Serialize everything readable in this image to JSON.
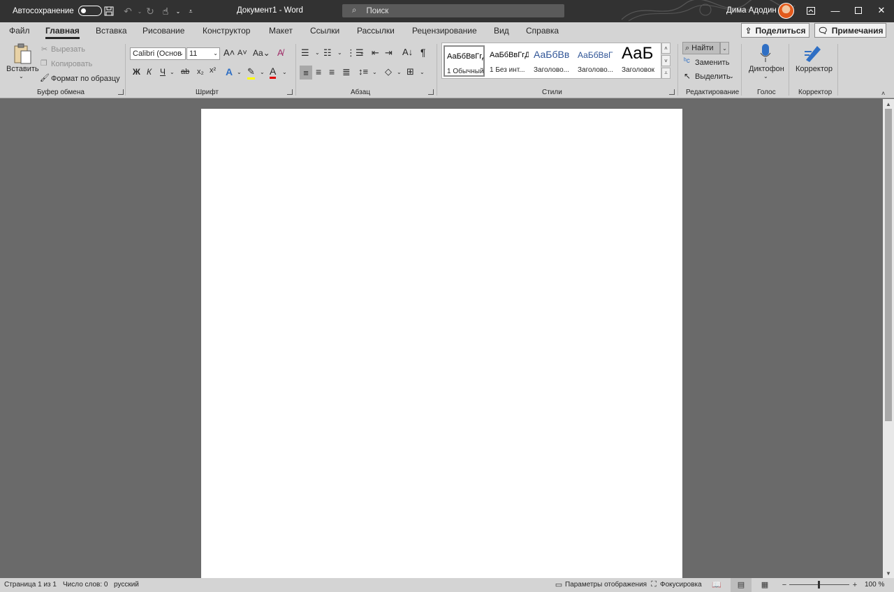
{
  "titlebar": {
    "autosave_label": "Автосохранение",
    "doc_title": "Документ1  -  Word",
    "search_placeholder": "Поиск",
    "user_name": "Дима Адодин"
  },
  "tabs": [
    "Файл",
    "Главная",
    "Вставка",
    "Рисование",
    "Конструктор",
    "Макет",
    "Ссылки",
    "Рассылки",
    "Рецензирование",
    "Вид",
    "Справка"
  ],
  "active_tab": "Главная",
  "share_label": "Поделиться",
  "comments_label": "Примечания",
  "clipboard": {
    "paste": "Вставить",
    "cut": "Вырезать",
    "copy": "Копировать",
    "format_painter": "Формат по образцу",
    "group": "Буфер обмена"
  },
  "font": {
    "family": "Calibri (Основ",
    "size": "11",
    "bold": "Ж",
    "italic": "К",
    "underline": "Ч",
    "strike": "ab",
    "group": "Шрифт"
  },
  "paragraph": {
    "group": "Абзац"
  },
  "styles": {
    "items": [
      {
        "preview": "АаБбВвГгД",
        "name": "1 Обычный"
      },
      {
        "preview": "АаБбВвГгД",
        "name": "1 Без инт..."
      },
      {
        "preview": "АаБбВв",
        "name": "Заголово..."
      },
      {
        "preview": "АаБбВвГ",
        "name": "Заголово..."
      },
      {
        "preview": "АаБ",
        "name": "Заголовок"
      }
    ],
    "group": "Стили"
  },
  "editing": {
    "find": "Найти",
    "replace": "Заменить",
    "select": "Выделить",
    "group": "Редактирование"
  },
  "voice": {
    "dictate": "Диктофон",
    "group": "Голос"
  },
  "editor": {
    "label": "Корректор",
    "group": "Корректор"
  },
  "statusbar": {
    "page": "Страница 1 из 1",
    "words": "Число слов: 0",
    "language": "русский",
    "display_settings": "Параметры отображения",
    "focus": "Фокусировка",
    "zoom": "100 %"
  },
  "colors": {
    "titlebar": "#323232",
    "ribbon": "#d4d4d4",
    "canvas": "#6a6a6a",
    "highlight": "#ffff00",
    "font_color": "#e00000"
  }
}
